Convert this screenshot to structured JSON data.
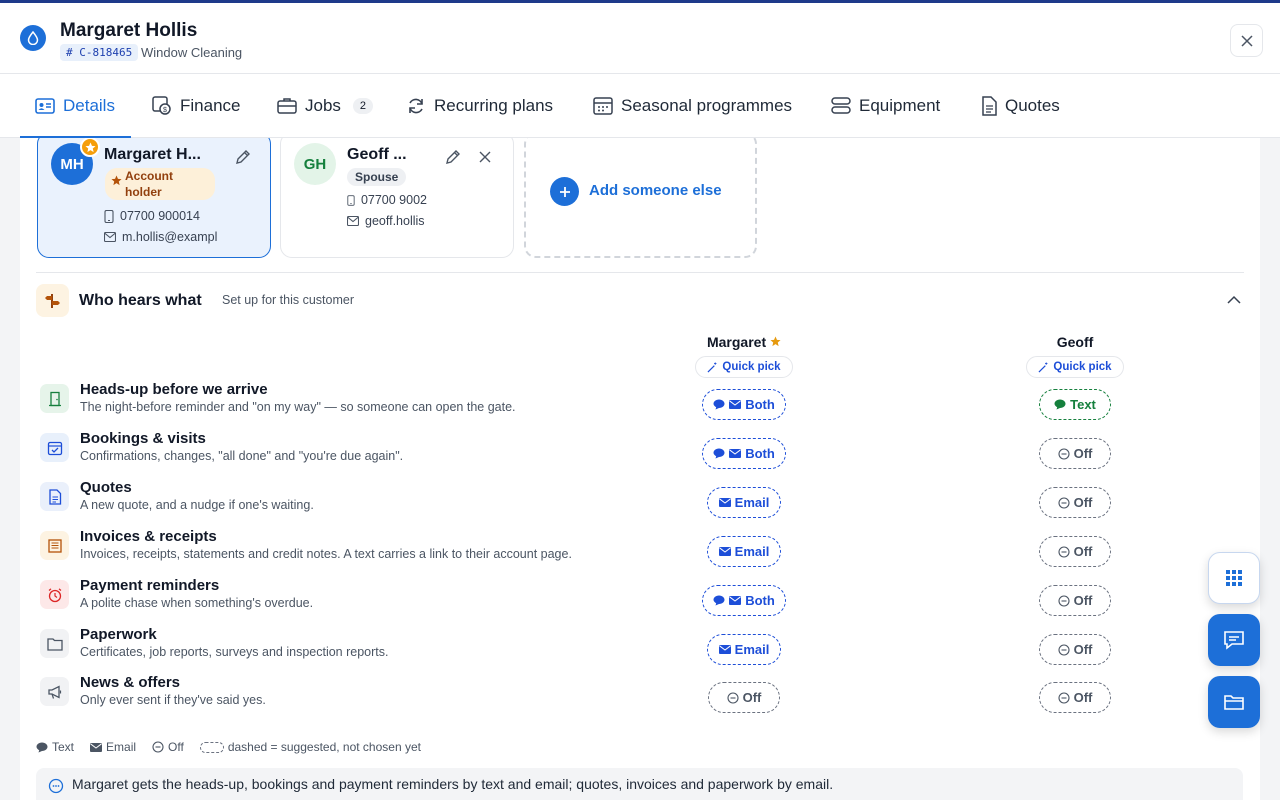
{
  "header": {
    "customer_name": "Margaret Hollis",
    "customer_id": "# C-818465",
    "service": "Window Cleaning"
  },
  "tabs": [
    {
      "label": "Details",
      "icon": "id-card-icon",
      "active": true
    },
    {
      "label": "Finance",
      "icon": "finance-icon"
    },
    {
      "label": "Jobs",
      "icon": "briefcase-icon",
      "badge": "2"
    },
    {
      "label": "Recurring plans",
      "icon": "refresh-icon"
    },
    {
      "label": "Seasonal programmes",
      "icon": "calendar-icon"
    },
    {
      "label": "Equipment",
      "icon": "server-icon"
    },
    {
      "label": "Quotes",
      "icon": "document-icon"
    }
  ],
  "people": [
    {
      "initials": "MH",
      "name": "Margaret H...",
      "role": "Account holder",
      "phone": "07700 900014",
      "email": "m.hollis@exampl"
    },
    {
      "initials": "GH",
      "name": "Geoff ...",
      "role": "Spouse",
      "phone": "07700 9002",
      "email": "geoff.hollis"
    }
  ],
  "add_person": {
    "label": "Add someone else"
  },
  "who_hears": {
    "title": "Who hears what",
    "subtitle": "Set up for this customer",
    "columns": [
      {
        "name": "Margaret",
        "quick_pick": "Quick pick"
      },
      {
        "name": "Geoff",
        "quick_pick": "Quick pick"
      }
    ],
    "rows": [
      {
        "title": "Heads-up before we arrive",
        "desc": "The night-before reminder and \"on my way\" — so someone can open the gate.",
        "icon": "door-icon",
        "margaret": "Both",
        "geoff": "Text"
      },
      {
        "title": "Bookings & visits",
        "desc": "Confirmations, changes, \"all done\" and \"you're due again\".",
        "icon": "calendar-check-icon",
        "margaret": "Both",
        "geoff": "Off"
      },
      {
        "title": "Quotes",
        "desc": "A new quote, and a nudge if one's waiting.",
        "icon": "document-icon",
        "margaret": "Email",
        "geoff": "Off"
      },
      {
        "title": "Invoices & receipts",
        "desc": "Invoices, receipts, statements and credit notes. A text carries a link to their account page.",
        "icon": "receipt-icon",
        "margaret": "Email",
        "geoff": "Off"
      },
      {
        "title": "Payment reminders",
        "desc": "A polite chase when something's overdue.",
        "icon": "alarm-clock-icon",
        "margaret": "Both",
        "geoff": "Off"
      },
      {
        "title": "Paperwork",
        "desc": "Certificates, job reports, surveys and inspection reports.",
        "icon": "folder-icon",
        "margaret": "Email",
        "geoff": "Off"
      },
      {
        "title": "News & offers",
        "desc": "Only ever sent if they've said yes.",
        "icon": "megaphone-icon",
        "margaret": "Off",
        "geoff": "Off"
      }
    ],
    "legend": {
      "text": "Text",
      "email": "Email",
      "off": "Off",
      "dashed": "dashed = suggested, not chosen yet"
    },
    "summary": "Margaret gets the heads-up, bookings and payment reminders by text and email; quotes, invoices and paperwork by email."
  },
  "colors": {
    "accent": "#1d6fd8",
    "text_green": "#15803d",
    "star": "#f59e0b"
  }
}
